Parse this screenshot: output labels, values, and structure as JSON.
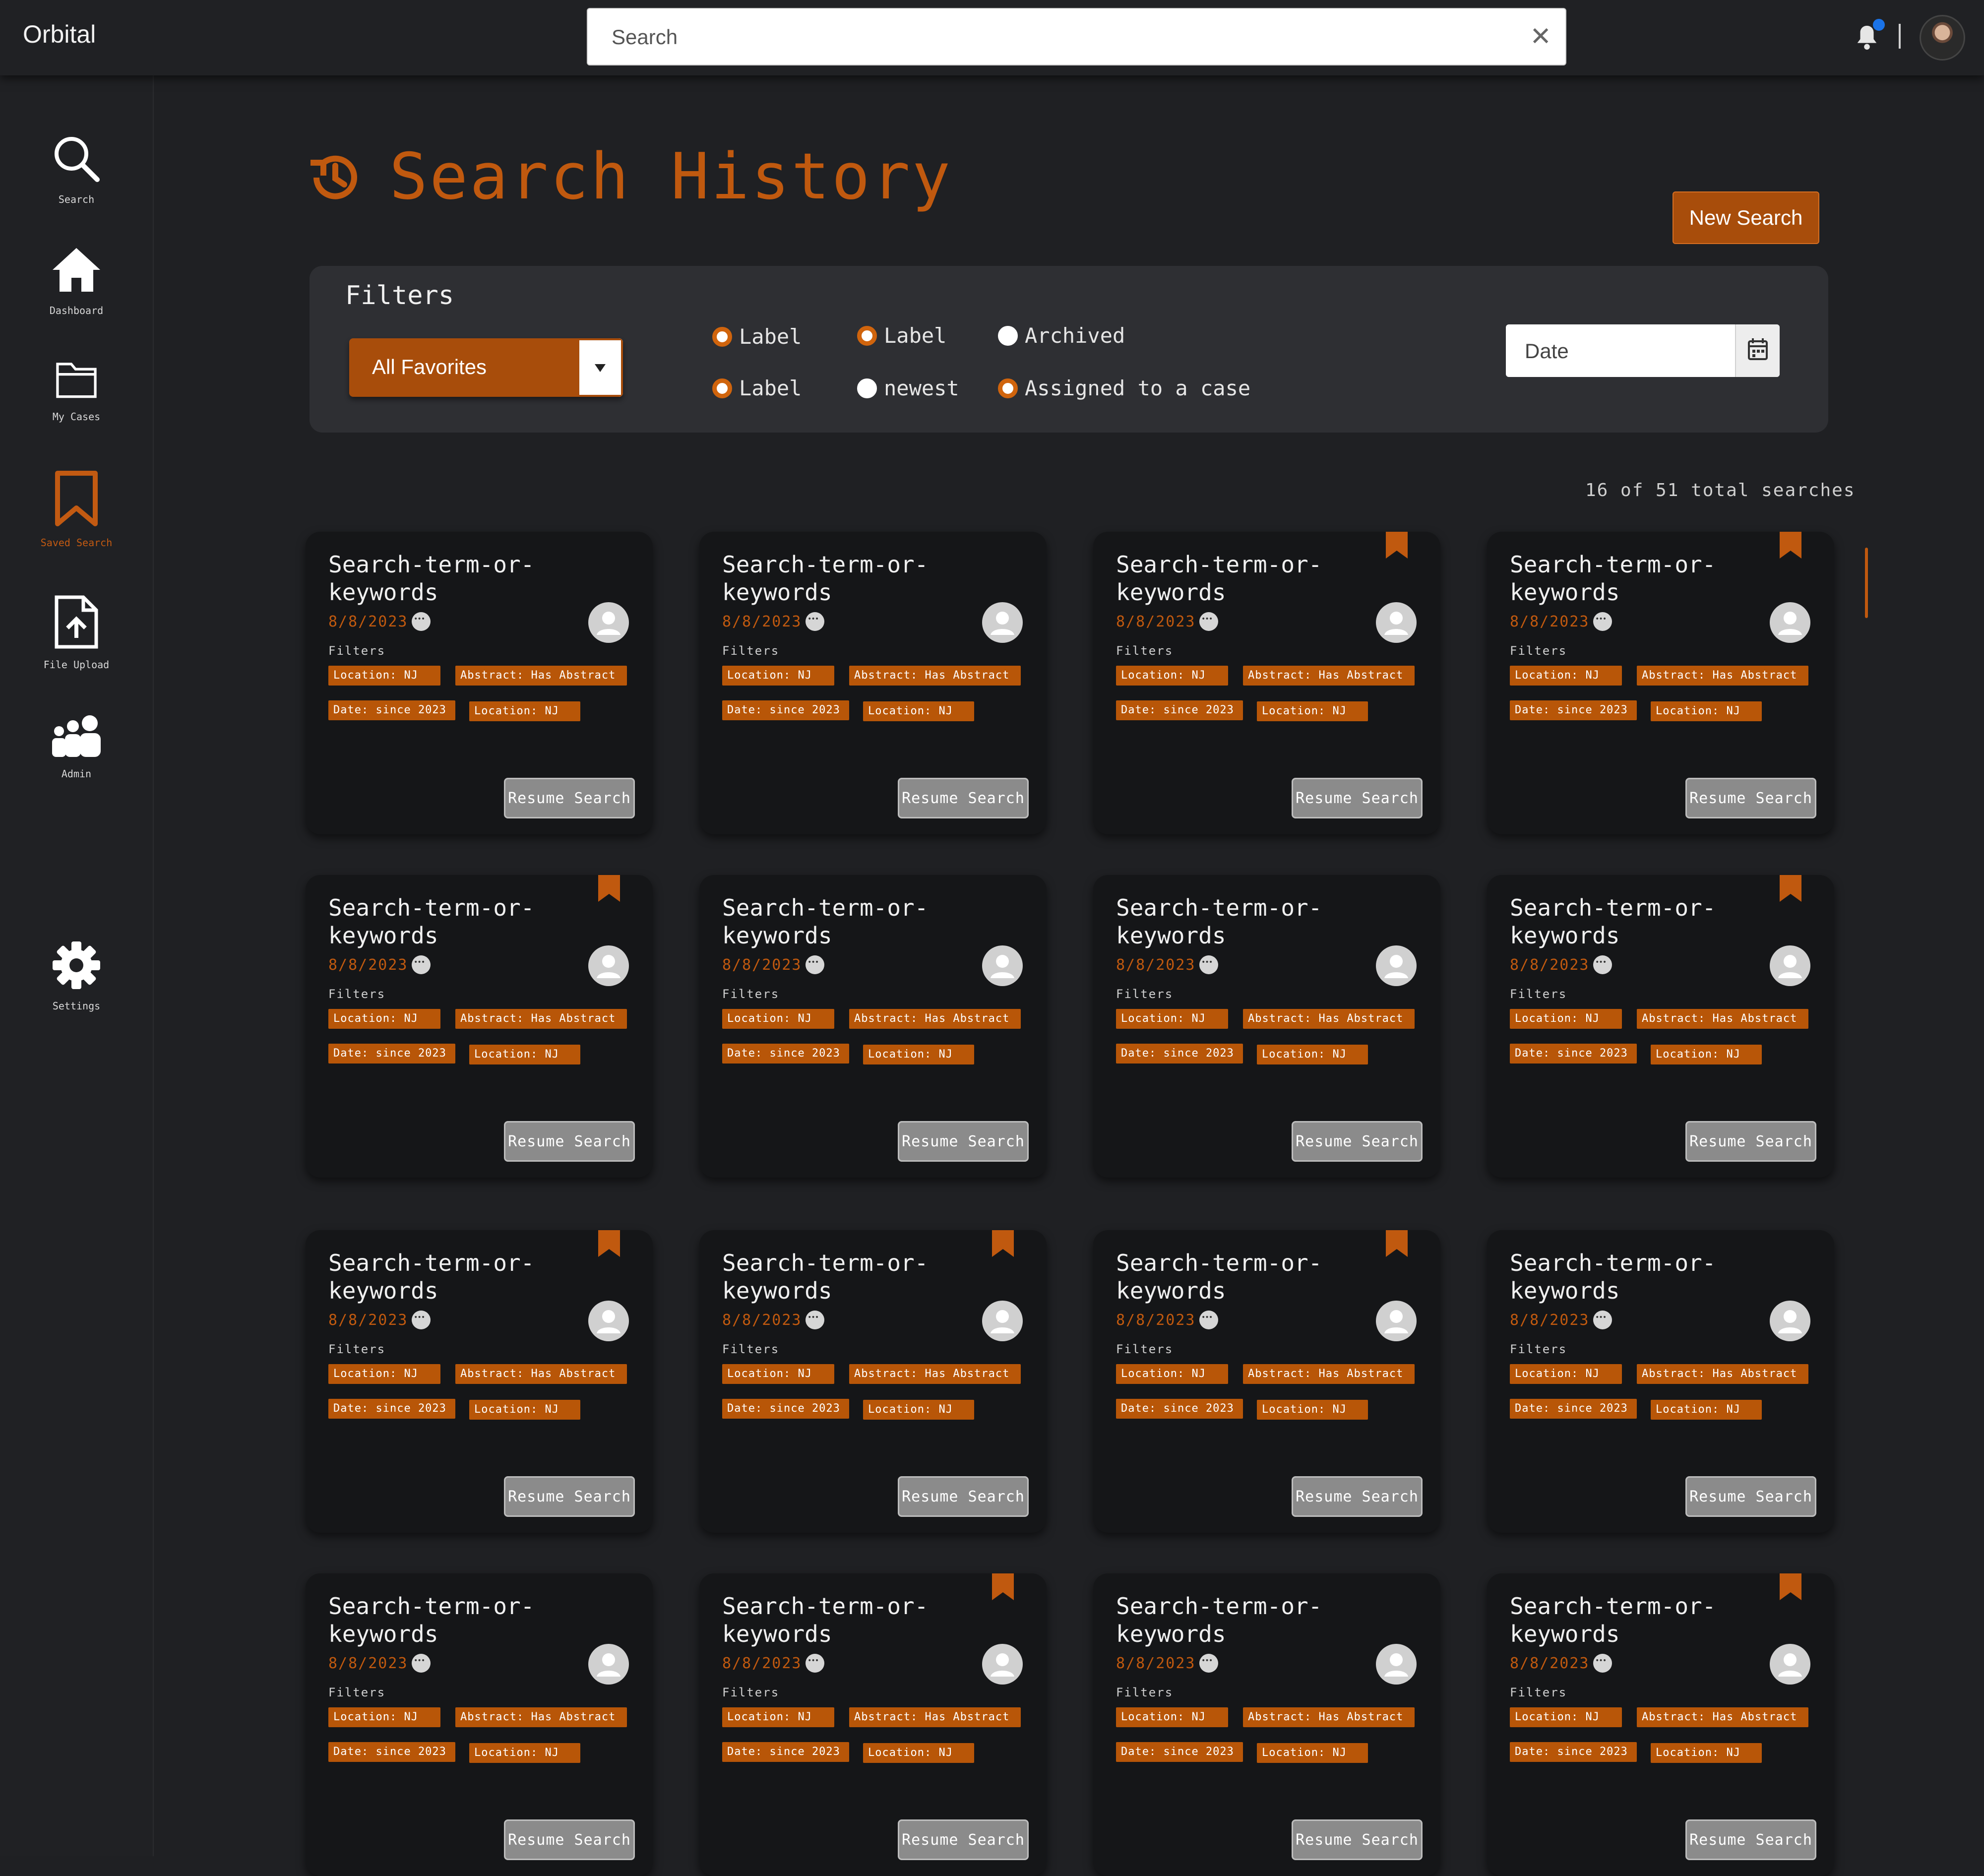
{
  "app": {
    "title": "Orbital"
  },
  "search": {
    "placeholder": "Search",
    "clear_glyph": "✕"
  },
  "sidebar": {
    "items": [
      {
        "label": "Search",
        "icon": "search-icon"
      },
      {
        "label": "Dashboard",
        "icon": "home-icon"
      },
      {
        "label": "My Cases",
        "icon": "folder-icon"
      },
      {
        "label": "Saved Search",
        "icon": "bookmark-icon",
        "active": true
      },
      {
        "label": "File Upload",
        "icon": "file-upload-icon"
      },
      {
        "label": "Admin",
        "icon": "users-icon"
      },
      {
        "label": "Settings",
        "icon": "gear-icon"
      }
    ]
  },
  "page": {
    "title": "Search History",
    "new_search_label": "New Search"
  },
  "filters": {
    "title": "Filters",
    "favorites_value": "All Favorites",
    "radios": [
      {
        "label": "Label",
        "selected": true
      },
      {
        "label": "Label",
        "selected": true
      },
      {
        "label": "Archived",
        "selected": false
      },
      {
        "label": "Label",
        "selected": true
      },
      {
        "label": "newest",
        "selected": false
      },
      {
        "label": "Assigned to a case",
        "selected": true
      }
    ],
    "date_placeholder": "Date"
  },
  "results": {
    "count_text": "16 of 51 total searches"
  },
  "card_text": {
    "title": "Search-term-or-keywords",
    "date": "8/8/2023",
    "filters_label": "Filters",
    "chips": [
      "Location: NJ",
      "Abstract: Has Abstract",
      "Date: since 2023",
      "Location: NJ"
    ],
    "resume_label": "Resume Search"
  },
  "cards": [
    {
      "bookmarked": false
    },
    {
      "bookmarked": false
    },
    {
      "bookmarked": true
    },
    {
      "bookmarked": true
    },
    {
      "bookmarked": true
    },
    {
      "bookmarked": false
    },
    {
      "bookmarked": false
    },
    {
      "bookmarked": true
    },
    {
      "bookmarked": true
    },
    {
      "bookmarked": true
    },
    {
      "bookmarked": true
    },
    {
      "bookmarked": false
    },
    {
      "bookmarked": false
    },
    {
      "bookmarked": true
    },
    {
      "bookmarked": false
    },
    {
      "bookmarked": true
    }
  ],
  "colors": {
    "accent": "#c0590f",
    "chip": "#b85608",
    "button": "#a84d0b",
    "background": "#1f2023",
    "card": "#151618",
    "notification": "#1a73e8"
  }
}
